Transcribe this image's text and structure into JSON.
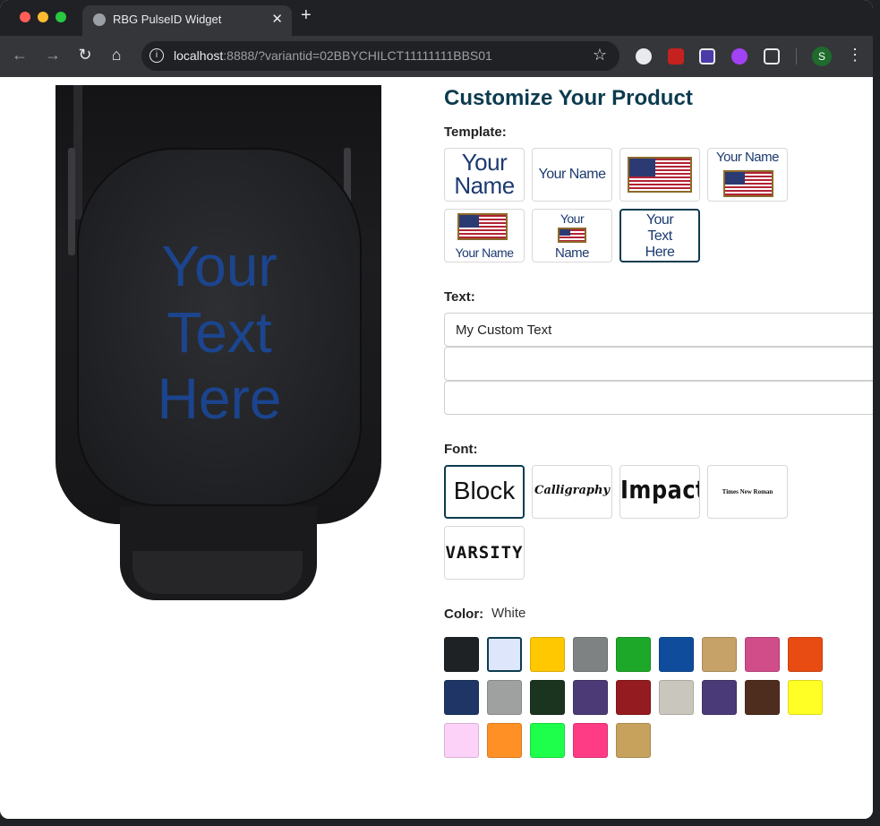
{
  "browser": {
    "tab_title": "RBG PulseID Widget",
    "tab_close": "✕",
    "new_tab": "+",
    "url_host": "localhost",
    "url_rest": ":8888/?variantid=02BBYCHILCT11111111BBS01",
    "back_icon": "←",
    "forward_icon": "→",
    "reload_icon": "↻",
    "home_icon": "⌂",
    "info_icon": "i",
    "star_icon": "☆",
    "profile_initial": "S",
    "menu_icon": "⋮"
  },
  "product": {
    "preview_text_lines": [
      "Your",
      "Text",
      "Here"
    ],
    "preview_text_color": "#1a4aa0"
  },
  "customizer": {
    "heading": "Customize Your Product",
    "template_label": "Template:",
    "templates": [
      {
        "id": "name-large",
        "line1": "Your",
        "line2": "Name"
      },
      {
        "id": "name-small",
        "line1": "Your Name"
      },
      {
        "id": "flag-only"
      },
      {
        "id": "name-above-flag",
        "line1": "Your Name"
      },
      {
        "id": "flag-above-name",
        "line1": "Your Name"
      },
      {
        "id": "name-flag-name",
        "line1": "Your",
        "line2": "Name"
      },
      {
        "id": "three-lines",
        "line1": "Your",
        "line2": "Text",
        "line3": "Here",
        "selected": true
      }
    ],
    "text_label": "Text:",
    "text_inputs": [
      "My Custom Text",
      "",
      ""
    ],
    "font_label": "Font:",
    "fonts": [
      {
        "name": "Block",
        "selected": true
      },
      {
        "name": "Calligraphy"
      },
      {
        "name": "Impact"
      },
      {
        "name": "Times New Roman"
      },
      {
        "name": "VARSITY"
      }
    ],
    "color_label": "Color:",
    "color_value": "White",
    "colors": [
      "#1e2224",
      "#dde6fb",
      "#ffc800",
      "#7f8283",
      "#1ea82a",
      "#0f4d9c",
      "#c6a268",
      "#d04d8a",
      "#e84c13",
      "#1e3566",
      "#9ea1a0",
      "#1b3420",
      "#4b3a75",
      "#941b1f",
      "#c9c7bd",
      "#4a3b78",
      "#4e2d1f",
      "#ffff26",
      "#fdd2f8",
      "#ff9026",
      "#1eff4b",
      "#fe3b85",
      "#c6a25d"
    ],
    "selected_color_index": 1
  }
}
